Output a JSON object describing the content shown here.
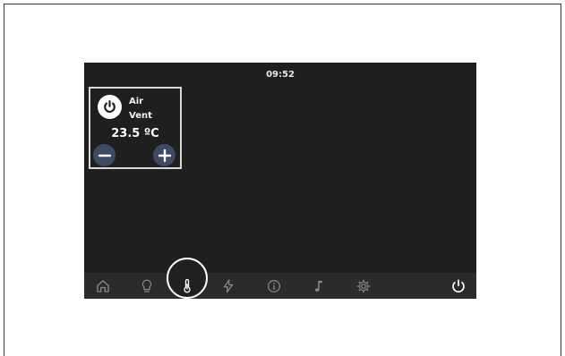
{
  "status_bar": {
    "time": "09:52"
  },
  "vent_control": {
    "title_line1": "Air",
    "title_line2": "Vent",
    "temperature": "23.5 ºC"
  },
  "nav": {
    "active": "climate",
    "items": [
      {
        "id": "home",
        "icon": "home-icon"
      },
      {
        "id": "lights",
        "icon": "lightbulb-icon"
      },
      {
        "id": "climate",
        "icon": "thermometer-icon"
      },
      {
        "id": "power",
        "icon": "lightning-icon"
      },
      {
        "id": "info",
        "icon": "info-icon"
      },
      {
        "id": "music",
        "icon": "music-note-icon"
      },
      {
        "id": "settings",
        "icon": "gear-icon"
      },
      {
        "id": "shutdown",
        "icon": "power-icon"
      }
    ]
  },
  "colors": {
    "screen_bg": "#1f1f1f",
    "bar_bg": "#2b2b2b",
    "button_bg": "#3d4a63",
    "icon_inactive": "#8a8a8a",
    "icon_active": "#ffffff"
  }
}
